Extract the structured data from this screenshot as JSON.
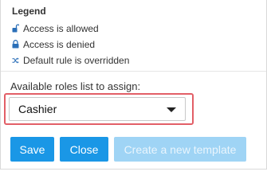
{
  "legend": {
    "title": "Legend",
    "items": [
      {
        "icon": "unlocked-padlock-icon",
        "label": "Access is allowed"
      },
      {
        "icon": "locked-padlock-icon",
        "label": "Access is denied"
      },
      {
        "icon": "shuffle-arrows-icon",
        "label": "Default rule is overridden"
      }
    ]
  },
  "roles": {
    "label": "Available roles list to assign:",
    "selected": "Cashier"
  },
  "buttons": {
    "save": "Save",
    "close": "Close",
    "create_template": "Create a new template",
    "create_template_enabled": false
  },
  "colors": {
    "primary": "#1a97e6",
    "disabled": "#9fd4f5",
    "highlight": "#e25f67",
    "icon": "#2b6fb8"
  }
}
